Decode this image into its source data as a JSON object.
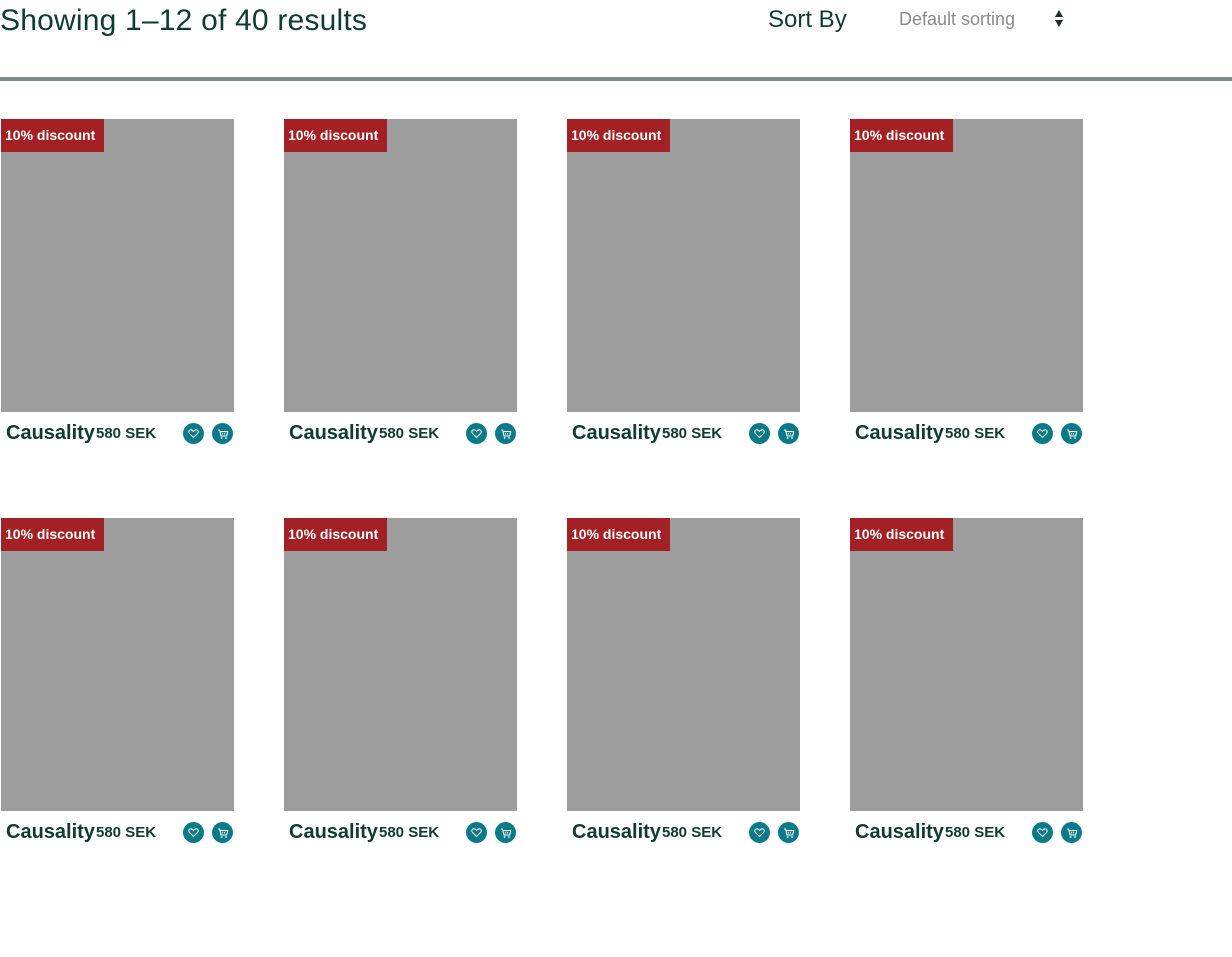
{
  "results": {
    "summary": "Showing 1–12 of 40 results"
  },
  "sort": {
    "label": "Sort By",
    "selected": "Default sorting"
  },
  "colors": {
    "heading": "#0f3b30",
    "badge": "#a32124",
    "icon_button": "#0b7a88",
    "image_placeholder": "#9d9d9d",
    "divider": "#7e8c86"
  },
  "products": [
    {
      "badge": "10% discount",
      "title": "Causality",
      "price": "580 SEK",
      "wishlist_icon": "heart-icon",
      "cart_icon": "cart-icon"
    },
    {
      "badge": "10% discount",
      "title": "Causality",
      "price": "580 SEK",
      "wishlist_icon": "heart-icon",
      "cart_icon": "cart-icon"
    },
    {
      "badge": "10% discount",
      "title": "Causality",
      "price": "580 SEK",
      "wishlist_icon": "heart-icon",
      "cart_icon": "cart-icon"
    },
    {
      "badge": "10% discount",
      "title": "Causality",
      "price": "580 SEK",
      "wishlist_icon": "heart-icon",
      "cart_icon": "cart-icon"
    },
    {
      "badge": "10% discount",
      "title": "Causality",
      "price": "580 SEK",
      "wishlist_icon": "heart-icon",
      "cart_icon": "cart-icon"
    },
    {
      "badge": "10% discount",
      "title": "Causality",
      "price": "580 SEK",
      "wishlist_icon": "heart-icon",
      "cart_icon": "cart-icon"
    },
    {
      "badge": "10% discount",
      "title": "Causality",
      "price": "580 SEK",
      "wishlist_icon": "heart-icon",
      "cart_icon": "cart-icon"
    },
    {
      "badge": "10% discount",
      "title": "Causality",
      "price": "580 SEK",
      "wishlist_icon": "heart-icon",
      "cart_icon": "cart-icon"
    }
  ]
}
